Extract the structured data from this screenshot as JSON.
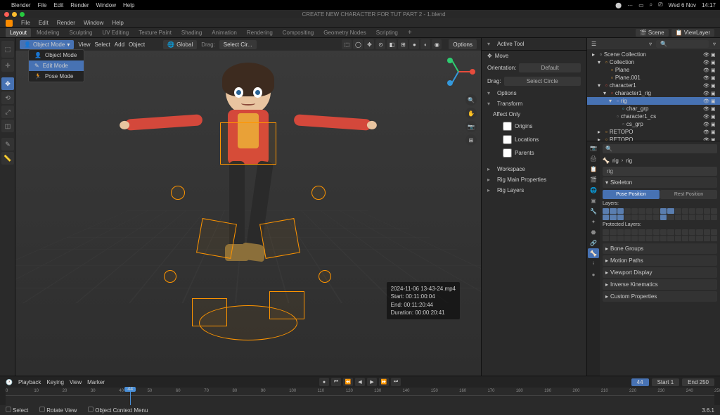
{
  "macos": {
    "app": "Blender",
    "menus": [
      "File",
      "Edit",
      "Render",
      "Window",
      "Help"
    ],
    "date": "Wed 6 Nov",
    "time": "14:17"
  },
  "window_title": "CREATE NEW CHARACTER FOR TUT PART 2 - 1.blend",
  "workspaces": [
    "Layout",
    "Modeling",
    "Sculpting",
    "UV Editing",
    "Texture Paint",
    "Shading",
    "Animation",
    "Rendering",
    "Compositing",
    "Geometry Nodes",
    "Scripting"
  ],
  "active_workspace": "Layout",
  "scene": {
    "scene_label": "Scene",
    "viewlayer_label": "ViewLayer"
  },
  "viewport": {
    "mode_current": "Object Mode",
    "mode_options": [
      "Object Mode",
      "Edit Mode",
      "Pose Mode"
    ],
    "mode_selected": "Edit Mode",
    "header_menus": [
      "View",
      "Select",
      "Add",
      "Object"
    ],
    "orientation": "Global",
    "drag": "Drag:",
    "select_tool": "Select Cir...",
    "options_label": "Options"
  },
  "n_panel": {
    "active_tool": "Active Tool",
    "move": "Move",
    "orientation_label": "Orientation:",
    "orientation_value": "Default",
    "drag_label": "Drag:",
    "drag_value": "Select Circle",
    "options": "Options",
    "transform": "Transform",
    "affect_only": "Affect Only",
    "affect_opts": [
      "Origins",
      "Locations",
      "Parents"
    ],
    "workspace": "Workspace",
    "rig_main": "Rig Main Properties",
    "rig_layers": "Rig Layers"
  },
  "outliner": {
    "rows": [
      {
        "indent": 0,
        "icon": "▸",
        "label": "Scene Collection",
        "type": "scene"
      },
      {
        "indent": 1,
        "icon": "▾",
        "label": "Collection",
        "color": "#e8a23a"
      },
      {
        "indent": 2,
        "icon": "",
        "label": "Plane",
        "color": "#e8a23a"
      },
      {
        "indent": 2,
        "icon": "",
        "label": "Plane.001",
        "color": "#e8a23a"
      },
      {
        "indent": 1,
        "icon": "▾",
        "label": "character1",
        "color": "#e74c3c"
      },
      {
        "indent": 2,
        "icon": "▾",
        "label": "character1_rig",
        "color": "#e74c3c"
      },
      {
        "indent": 3,
        "icon": "▾",
        "label": "rig",
        "color": "#aad",
        "sel": true
      },
      {
        "indent": 4,
        "icon": "",
        "label": "char_grp",
        "color": "#3bd"
      },
      {
        "indent": 3,
        "icon": "",
        "label": "character1_cs",
        "color": "#888"
      },
      {
        "indent": 4,
        "icon": "",
        "label": "cs_grp",
        "color": "#888"
      },
      {
        "indent": 1,
        "icon": "▸",
        "label": "RETOPO",
        "color": "#e8a23a"
      },
      {
        "indent": 1,
        "icon": "▸",
        "label": "RETOPO",
        "color": "#e8a23a"
      }
    ]
  },
  "properties": {
    "search_placeholder": "",
    "breadcrumb": [
      "rig",
      "rig"
    ],
    "armature_name": "rig",
    "skeleton": "Skeleton",
    "pose_position": "Pose Position",
    "rest_position": "Rest Position",
    "layers": "Layers:",
    "protected_layers": "Protected Layers:",
    "sections": [
      "Bone Groups",
      "Motion Paths",
      "Viewport Display",
      "Inverse Kinematics",
      "Custom Properties"
    ]
  },
  "timeline": {
    "menus": [
      "Playback",
      "Keying",
      "View",
      "Marker"
    ],
    "current": 44,
    "start_label": "Start",
    "start": 1,
    "end_label": "End",
    "end": 250,
    "ticks": [
      0,
      10,
      20,
      30,
      40,
      50,
      60,
      70,
      80,
      90,
      100,
      110,
      120,
      130,
      140,
      150,
      160,
      170,
      180,
      190,
      200,
      210,
      220,
      230,
      240,
      250
    ]
  },
  "overlay": {
    "line1": "2024-11-06 13-43-24.mp4",
    "line2": "Start: 00:11:00:04",
    "line3": "End: 00:11:20:44",
    "line4": "Duration: 00:00:20:41"
  },
  "status": {
    "select": "Select",
    "rotate": "Rotate View",
    "context": "Object Context Menu",
    "version": "3.6.1"
  }
}
